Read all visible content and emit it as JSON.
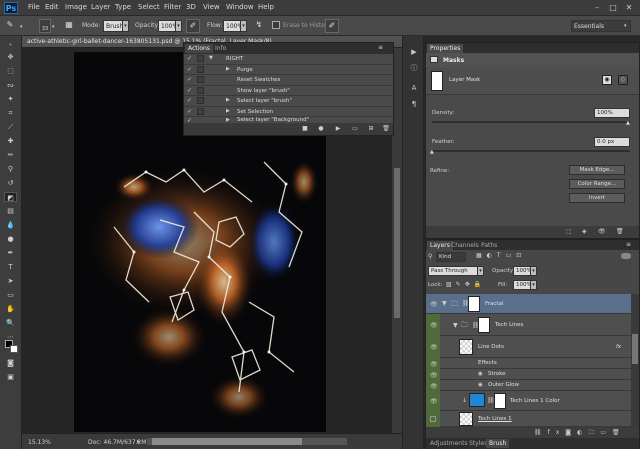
{
  "app": {
    "logo": "Ps"
  },
  "menubar": {
    "items": [
      "File",
      "Edit",
      "Image",
      "Layer",
      "Type",
      "Select",
      "Filter",
      "3D",
      "View",
      "Window",
      "Help"
    ]
  },
  "options": {
    "size": "33",
    "mode_label": "Mode:",
    "mode_value": "Brush",
    "opacity_label": "Opacity:",
    "opacity_value": "100%",
    "flow_label": "Flow:",
    "flow_value": "100%",
    "erase_history": "Erase to History",
    "workspace": "Essentials"
  },
  "document": {
    "title": "active-athletic-girl-ballet-dancer-163805131.psd @ 15.1% (Fractal, Layer Mask/8)",
    "zoom": "15.13%",
    "doc_size": "Doc: 46.7M/637.2M"
  },
  "actions_panel": {
    "tabs": [
      "Actions",
      "Info"
    ],
    "rows": [
      {
        "label": "RIGHT",
        "level": 1,
        "expanded": true
      },
      {
        "label": "Purge",
        "level": 2
      },
      {
        "label": "Reset Swatches",
        "level": 2
      },
      {
        "label": "Show layer \"brush\"",
        "level": 2
      },
      {
        "label": "Select layer \"brush\"",
        "level": 2
      },
      {
        "label": "Set Selection",
        "level": 2
      },
      {
        "label": "Select layer \"Background\"",
        "level": 2
      }
    ]
  },
  "properties": {
    "tab": "Properties",
    "header": "Masks",
    "mask_label": "Layer Mask",
    "density_label": "Density:",
    "density_value": "100%",
    "density_fraction": 1.0,
    "feather_label": "Feather:",
    "feather_value": "0.0 px",
    "feather_fraction": 0.0,
    "refine_label": "Refine:",
    "mask_edge": "Mask Edge...",
    "color_range": "Color Range...",
    "invert": "Invert"
  },
  "layers_panel": {
    "tabs": [
      "Layers",
      "Channels",
      "Paths"
    ],
    "kind": "Kind",
    "blend": "Pass Through",
    "opacity_label": "Opacity:",
    "opacity_value": "100%",
    "lock_label": "Lock:",
    "fill_label": "Fill:",
    "fill_value": "100%",
    "layers": [
      {
        "name": "Fractal",
        "type": "group"
      },
      {
        "name": "Tech Lines",
        "type": "group"
      },
      {
        "name": "Line Dots",
        "type": "layer",
        "fx": "fx"
      },
      {
        "name": "Effects",
        "type": "effects"
      },
      {
        "name": "Stroke",
        "type": "effect"
      },
      {
        "name": "Outer Glow",
        "type": "effect"
      },
      {
        "name": "Tech Lines 1 Color",
        "type": "fill"
      },
      {
        "name": "Tech Lines 1",
        "type": "layer"
      }
    ],
    "bottom_tabs": [
      "Adjustments",
      "Styles",
      "Brush"
    ]
  },
  "colors": {
    "selection": "#5a6f8c",
    "green_tag": "#4f6b3a",
    "accent_blue": "#1e87d8"
  }
}
